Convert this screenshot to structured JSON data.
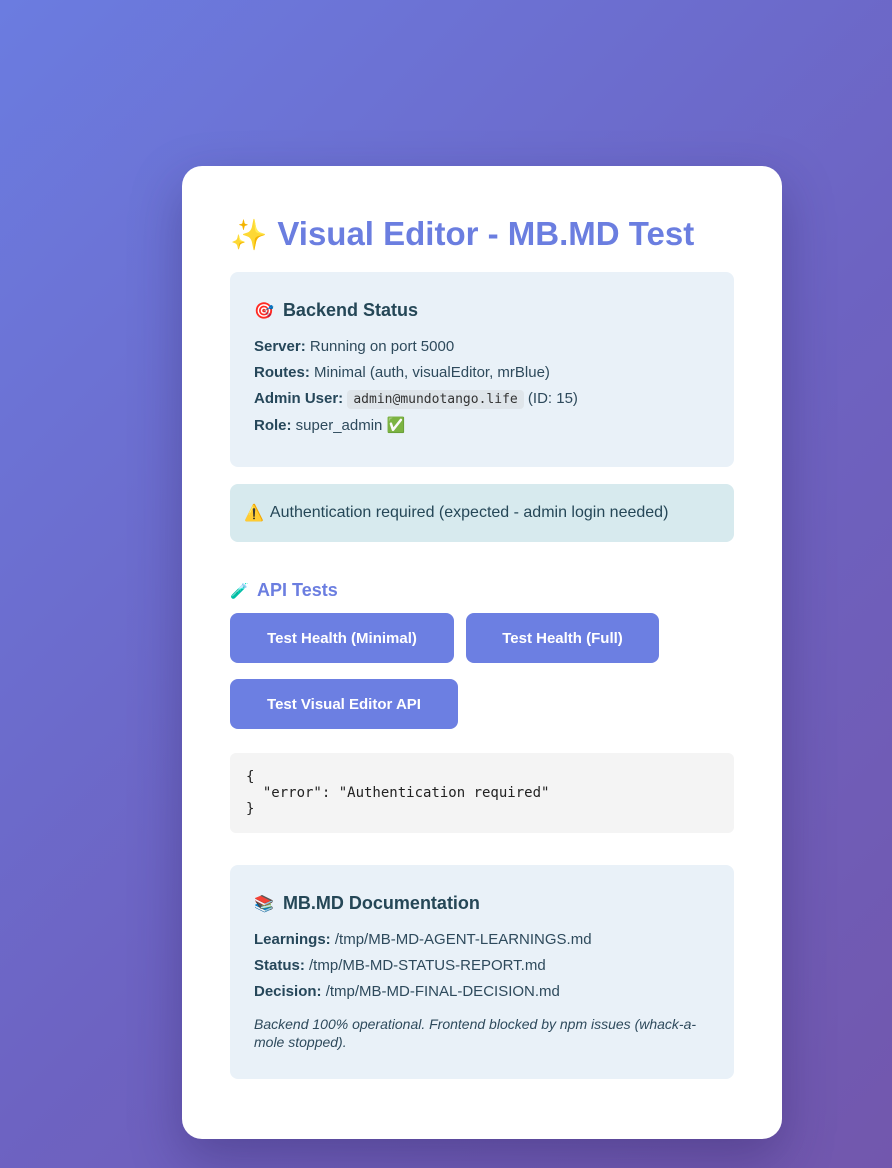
{
  "title": {
    "emoji": "✨",
    "text": "Visual Editor - MB.MD Test"
  },
  "backend_status": {
    "emoji": "🎯",
    "heading": "Backend Status",
    "server_label": "Server:",
    "server_value": "Running on port 5000",
    "routes_label": "Routes:",
    "routes_value": "Minimal (auth, visualEditor, mrBlue)",
    "admin_label": "Admin User:",
    "admin_email": "admin@mundotango.life",
    "admin_id": "(ID: 15)",
    "role_label": "Role:",
    "role_value": "super_admin",
    "role_badge": "✅"
  },
  "alert": {
    "emoji": "⚠️",
    "text": "Authentication required (expected - admin login needed)"
  },
  "api_tests": {
    "emoji": "🧪",
    "heading": "API Tests",
    "buttons": [
      {
        "label": "Test Health (Minimal)"
      },
      {
        "label": "Test Health (Full)"
      },
      {
        "label": "Test Visual Editor API"
      }
    ]
  },
  "result": {
    "text": "{\n  \"error\": \"Authentication required\"\n}"
  },
  "docs": {
    "emoji": "📚",
    "heading": "MB.MD Documentation",
    "learnings_label": "Learnings:",
    "learnings_value": "/tmp/MB-MD-AGENT-LEARNINGS.md",
    "status_label": "Status:",
    "status_value": "/tmp/MB-MD-STATUS-REPORT.md",
    "decision_label": "Decision:",
    "decision_value": "/tmp/MB-MD-FINAL-DECISION.md",
    "note": "Backend 100% operational. Frontend blocked by npm issues (whack-a-mole stopped)."
  },
  "colors": {
    "accent": "#6b7ee0",
    "button": "#6c7fe2",
    "panel_bg": "#e9f1f8",
    "alert_bg": "#d7eaee",
    "text_dark": "#254757"
  }
}
